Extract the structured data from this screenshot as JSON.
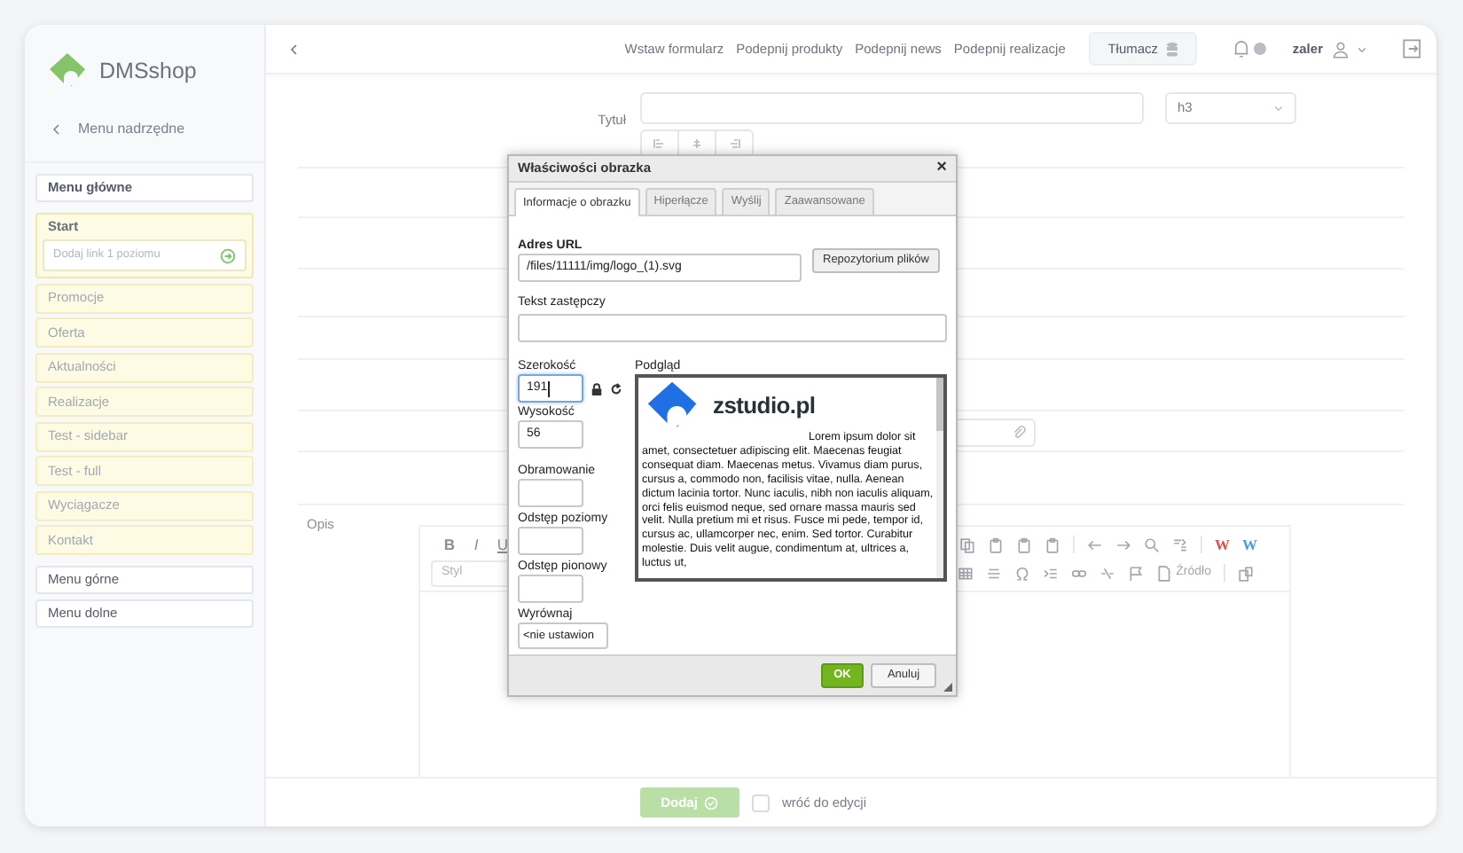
{
  "sidebar": {
    "brand": "DMSshop",
    "back_label": "Menu nadrzędne",
    "menus": [
      {
        "label": "Menu główne",
        "children": [
          {
            "label": "Start",
            "expanded": true,
            "add_placeholder": "Dodaj link 1 poziomu"
          },
          {
            "label": "Promocje",
            "expanded": false
          },
          {
            "label": "Oferta",
            "expanded": false
          },
          {
            "label": "Aktualności",
            "expanded": false
          },
          {
            "label": "Realizacje",
            "expanded": false
          },
          {
            "label": "Test - sidebar",
            "expanded": false
          },
          {
            "label": "Test - full",
            "expanded": false
          },
          {
            "label": "Wyciągacze",
            "expanded": false
          },
          {
            "label": "Kontakt",
            "expanded": false
          }
        ]
      },
      {
        "label": "Menu górne"
      },
      {
        "label": "Menu dolne"
      }
    ]
  },
  "header": {
    "links": [
      "Wstaw formularz",
      "Podepnij produkty",
      "Podepnij news",
      "Podepnij realizacje"
    ],
    "translate_button": "Tłumacz",
    "user": "zaler"
  },
  "form": {
    "title_label": "Tytuł",
    "heading_select": "h3",
    "description_label": "Opis"
  },
  "editor": {
    "format_buttons": [
      "B",
      "I",
      "U"
    ],
    "style_placeholder": "Styl",
    "word_buttons": [
      {
        "label": "W",
        "color": "#e05252"
      },
      {
        "label": "W",
        "color": "#4a9fe0"
      }
    ],
    "source_button": "Źródło"
  },
  "footer": {
    "add_button": "Dodaj",
    "return_checkbox": {
      "label": "wróć do edycji",
      "checked": false
    }
  },
  "dialog": {
    "title": "Właściwości obrazka",
    "close": "×",
    "tabs": [
      {
        "label": "Informacje o obrazku",
        "selected": true
      },
      {
        "label": "Hiperłącze",
        "selected": false
      },
      {
        "label": "Wyślij",
        "selected": false
      },
      {
        "label": "Zaawansowane",
        "selected": false
      }
    ],
    "url_label": "Adres URL",
    "url_value": "/files/11111/img/logo_(1).svg",
    "browse_button": "Repozytorium plików",
    "alt_label": "Tekst zastępczy",
    "width_label": "Szerokość",
    "width_value": "191",
    "height_label": "Wysokość",
    "height_value": "56",
    "border_label": "Obramowanie",
    "hspace_label": "Odstęp poziomy",
    "vspace_label": "Odstęp pionowy",
    "align_label": "Wyrównaj",
    "align_value": "<nie ustawion",
    "preview_label": "Podgląd",
    "preview_logo_text": "zstudio.pl",
    "preview_text": "Lorem ipsum dolor sit amet, consectetuer adipiscing elit. Maecenas feugiat consequat diam. Maecenas metus. Vivamus diam purus, cursus a, commodo non, facilisis vitae, nulla. Aenean dictum lacinia tortor. Nunc iaculis, nibh non iaculis aliquam, orci felis euismod neque, sed ornare massa mauris sed velit. Nulla pretium mi et risus. Fusce mi pede, tempor id, cursus ac, ullamcorper nec, enim. Sed tortor. Curabitur molestie. Duis velit augue, condimentum at, ultrices a, luctus ut,",
    "ok_button": "OK",
    "cancel_button": "Anuluj"
  }
}
